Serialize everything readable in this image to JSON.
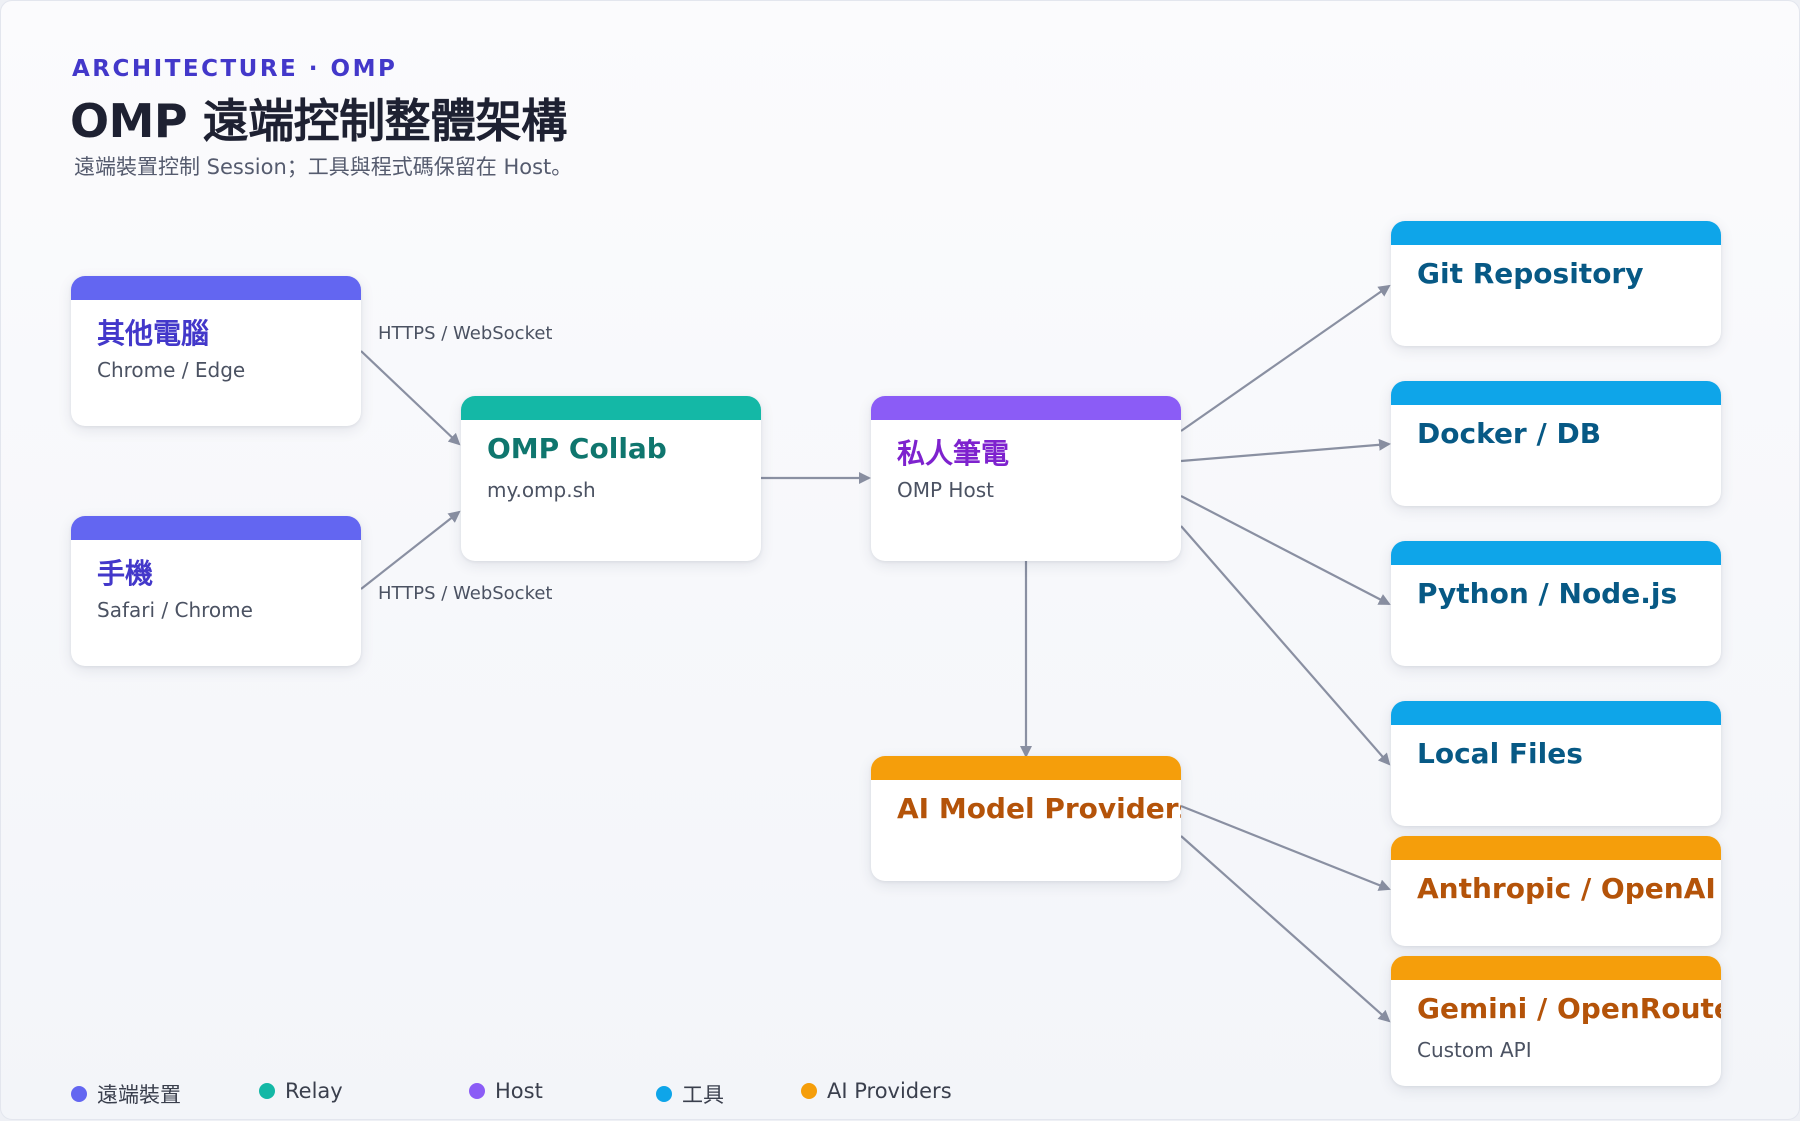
{
  "header": {
    "kicker": "ARCHITECTURE · OMP",
    "title": "OMP 遠端控制整體架構",
    "subtitle": "遠端裝置控制 Session；工具與程式碼保留在 Host。"
  },
  "colors": {
    "device": "#6366f1",
    "relay": "#14b8a6",
    "host": "#8b5cf6",
    "tool": "#0ea5e9",
    "ai": "#f59e0b",
    "edge": "#8a90a2"
  },
  "edge_labels": {
    "top": "HTTPS / WebSocket",
    "bottom": "HTTPS / WebSocket"
  },
  "nodes": {
    "other_pc": {
      "title": "其他電腦",
      "sub": "Chrome / Edge"
    },
    "phone": {
      "title": "手機",
      "sub": "Safari / Chrome"
    },
    "collab": {
      "title": "OMP Collab",
      "sub": "my.omp.sh"
    },
    "host": {
      "title": "私人筆電",
      "sub": "OMP Host"
    },
    "git": {
      "title": "Git Repository"
    },
    "docker": {
      "title": "Docker / DB"
    },
    "python": {
      "title": "Python / Node.js"
    },
    "files": {
      "title": "Local Files"
    },
    "ai": {
      "title": "AI Model Providers"
    },
    "anthropic": {
      "title": "Anthropic / OpenAI"
    },
    "gemini": {
      "title": "Gemini / OpenRouter",
      "sub": "Custom API"
    }
  },
  "legend": [
    {
      "label": "遠端裝置",
      "color": "#6366f1"
    },
    {
      "label": "Relay",
      "color": "#14b8a6"
    },
    {
      "label": "Host",
      "color": "#8b5cf6"
    },
    {
      "label": "工具",
      "color": "#0ea5e9"
    },
    {
      "label": "AI Providers",
      "color": "#f59e0b"
    }
  ]
}
